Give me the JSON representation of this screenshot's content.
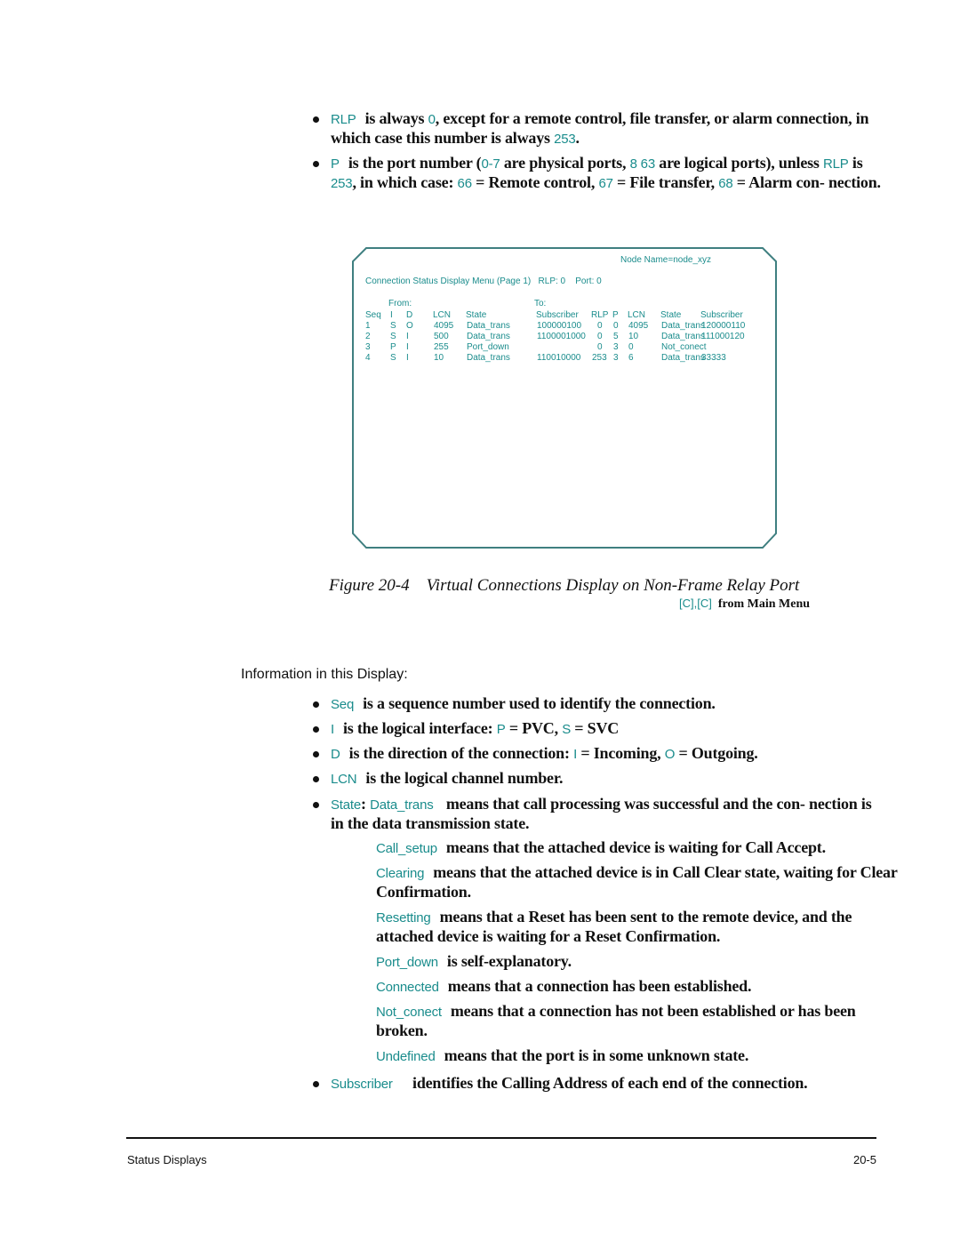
{
  "top_bullets": [
    {
      "term": "RLP",
      "parts": [
        {
          "t": "is always ",
          "teal": false
        },
        {
          "t": "0",
          "teal": true
        },
        {
          "t": ", except for a remote control, file transfer, or alarm connection, in which case this number is always ",
          "teal": false
        },
        {
          "t": "253",
          "teal": true
        },
        {
          "t": ".",
          "teal": false
        }
      ]
    },
    {
      "term": "P",
      "parts": [
        {
          "t": "is the port number (",
          "teal": false
        },
        {
          "t": "0-7",
          "teal": true
        },
        {
          "t": " are physical ports, ",
          "teal": false
        },
        {
          "t": "8 63",
          "teal": true
        },
        {
          "t": " are logical ports), unless ",
          "teal": false
        },
        {
          "t": "RLP",
          "teal": true
        },
        {
          "t": " is ",
          "teal": false
        },
        {
          "t": "253",
          "teal": true
        },
        {
          "t": ", in which case: ",
          "teal": false
        },
        {
          "t": "66",
          "teal": true
        },
        {
          "t": " = Remote control, ",
          "teal": false
        },
        {
          "t": "67",
          "teal": true
        },
        {
          "t": " = File transfer, ",
          "teal": false
        },
        {
          "t": "68",
          "teal": true
        },
        {
          "t": " = Alarm con- nection.",
          "teal": false
        }
      ]
    }
  ],
  "screen": {
    "node_name": "Node Name=node_xyz",
    "menu_line": "Connection Status Display Menu (Page 1)   RLP: 0    Port: 0",
    "from_label": "From:",
    "to_label": "To:",
    "columns": [
      "Seq",
      "I",
      "D",
      "LCN",
      "State",
      "Subscriber",
      "RLP",
      "P",
      "LCN",
      "State",
      "Subscriber"
    ],
    "rows": [
      [
        "1",
        "S",
        "O",
        "4095",
        "Data_trans",
        "100000100",
        "0",
        "0",
        "4095",
        "Data_trans",
        "120000110"
      ],
      [
        "2",
        "S",
        "I",
        "500",
        "Data_trans",
        "1100001000",
        "0",
        "5",
        "10",
        "Data_trans",
        "111000120"
      ],
      [
        "3",
        "P",
        "I",
        "255",
        "Port_down",
        "",
        "0",
        "3",
        "0",
        "Not_conect",
        ""
      ],
      [
        "4",
        "S",
        "I",
        "10",
        "Data_trans",
        "110010000",
        "253",
        "3",
        "6",
        "Data_trans",
        "33333"
      ]
    ]
  },
  "figure": {
    "number": "Figure 20-4",
    "title": "Virtual Connections Display on Non-Frame Relay Port",
    "keys": "[C],[C]",
    "from_menu": "from Main Menu"
  },
  "info_heading": "Information in this Display:",
  "info_bullets": [
    {
      "term": "Seq",
      "text": "is a sequence number used to identify the connection."
    },
    {
      "term": "I",
      "text": "is the logical interface: ",
      "extra": [
        {
          "t": "P",
          "teal": true
        },
        {
          "t": " = PVC, ",
          "teal": false
        },
        {
          "t": "S",
          "teal": true
        },
        {
          "t": " = SVC",
          "teal": false
        }
      ]
    },
    {
      "term": "D",
      "text": "is the direction of the connection: ",
      "extra": [
        {
          "t": "I",
          "teal": true
        },
        {
          "t": " = Incoming, ",
          "teal": false
        },
        {
          "t": "O",
          "teal": true
        },
        {
          "t": " = Outgoing.",
          "teal": false
        }
      ]
    },
    {
      "term": "LCN",
      "text": "is the logical channel number."
    }
  ],
  "state_label": "State",
  "states": [
    {
      "term": "Data_trans",
      "text": "means that call processing was successful and the con- nection is in the data transmission state."
    },
    {
      "term": "Call_setup",
      "text": "means that the attached device is waiting for Call Accept."
    },
    {
      "term": "Clearing",
      "text": "means that the attached device is in Call Clear state, waiting for Clear Confirmation."
    },
    {
      "term": "Resetting",
      "text": "means that a Reset has been sent to the remote device, and the attached device is waiting for a Reset Confirmation."
    },
    {
      "term": "Port_down",
      "text": "is self-explanatory."
    },
    {
      "term": "Connected",
      "text": "means that a connection has been established."
    },
    {
      "term": "Not_conect",
      "text": "means that a connection has not been established or has been broken."
    },
    {
      "term": "Undefined",
      "text": "means that the port is in some unknown state."
    }
  ],
  "subscriber_bullet": {
    "term": "Subscriber",
    "text": "identifies the Calling Address of each end of the connection."
  },
  "footer": {
    "section": "Status Displays",
    "page": "20-5"
  },
  "colors": {
    "accent": "#1a8c8c",
    "text": "#111111"
  }
}
